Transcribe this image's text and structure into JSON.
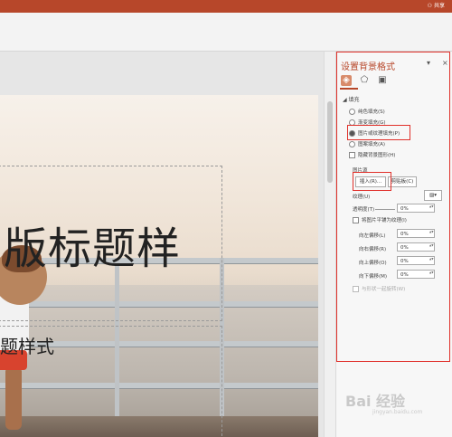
{
  "titlebar": {
    "share_label": "共享"
  },
  "slide": {
    "title_text": "版标题样",
    "subtitle_text": "题样式"
  },
  "pane": {
    "title": "设置背景格式",
    "dropdown_glyph": "▾",
    "close_glyph": "×",
    "tabs": [
      "fill-icon",
      "pentagon-icon",
      "picture-icon"
    ],
    "section_label": "填充",
    "options": [
      {
        "label": "纯色填充(S)",
        "selected": false
      },
      {
        "label": "渐变填充(G)",
        "selected": false
      },
      {
        "label": "图片或纹理填充(P)",
        "selected": true
      },
      {
        "label": "图案填充(A)",
        "selected": false
      }
    ],
    "hide_bg_label": "隐藏背景图形(H)",
    "picture_source_label": "图片源",
    "insert_button": "插入(R)...",
    "clipboard_button": "剪贴板(C)",
    "texture_label": "纹理(U)",
    "transparency_label": "透明度(T)",
    "transparency_value": "0%",
    "tile_label": "将图片平铺为纹理(I)",
    "offsets": [
      {
        "label": "向左偏移(L)",
        "value": "0%"
      },
      {
        "label": "向右偏移(R)",
        "value": "0%"
      },
      {
        "label": "向上偏移(O)",
        "value": "0%"
      },
      {
        "label": "向下偏移(M)",
        "value": "0%"
      }
    ],
    "rotate_label": "与形状一起旋转(W)"
  },
  "watermark": {
    "text": "Bai 经验",
    "sub": "jingyan.baidu.com"
  },
  "colors": {
    "accent": "#b7472a",
    "highlight": "#e0302a"
  }
}
